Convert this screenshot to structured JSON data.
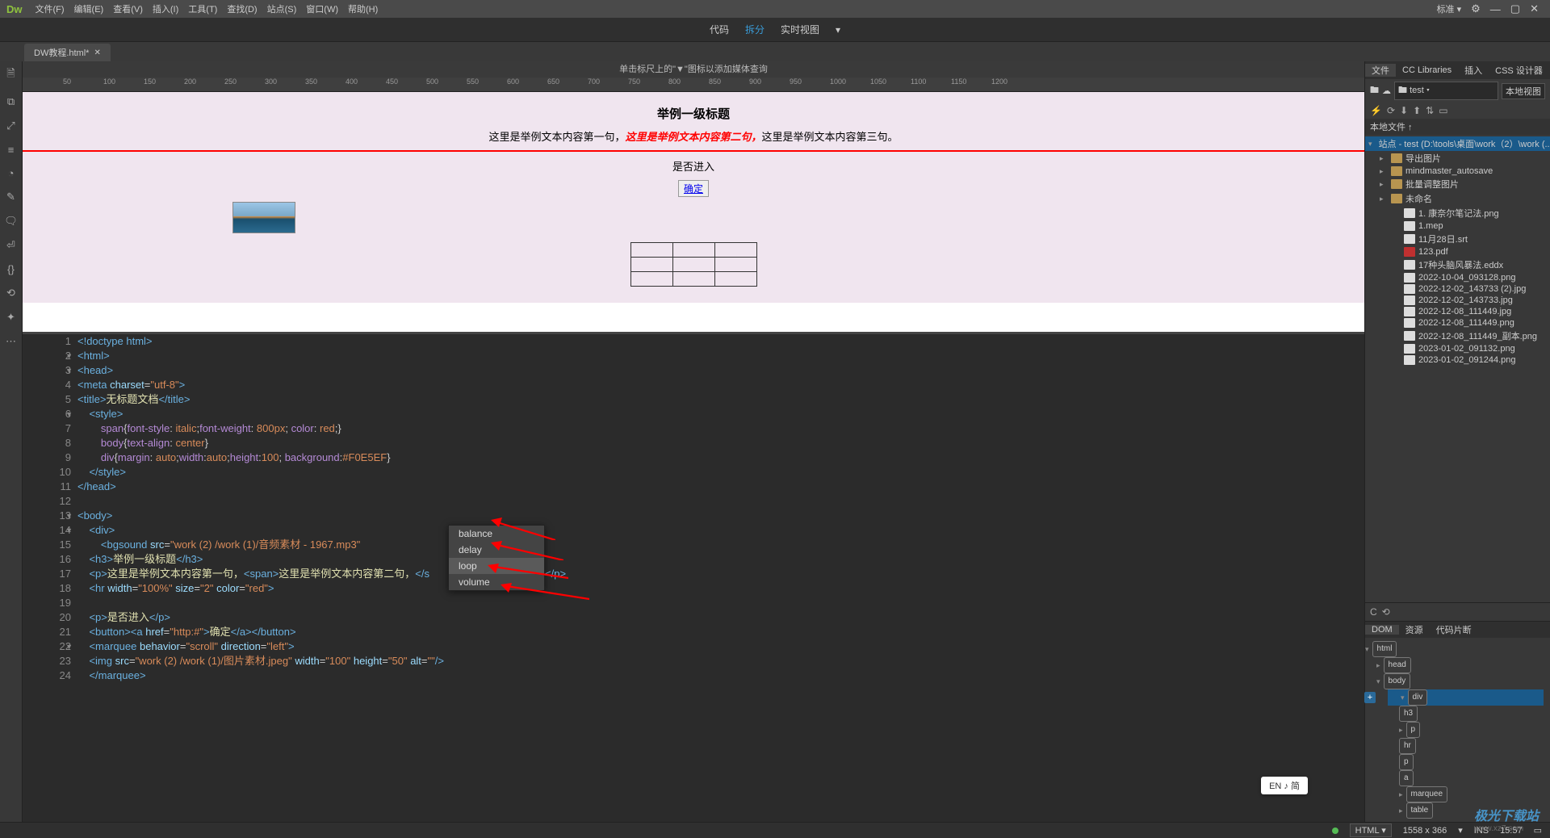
{
  "app": {
    "logo": "Dw"
  },
  "menubar": {
    "items": [
      "文件(F)",
      "编辑(E)",
      "查看(V)",
      "插入(I)",
      "工具(T)",
      "查找(D)",
      "站点(S)",
      "窗口(W)",
      "帮助(H)"
    ],
    "right_label": "标准 ▾"
  },
  "viewbar": {
    "code": "代码",
    "split": "拆分",
    "live": "实时视图"
  },
  "tab": {
    "name": "DW教程.html*"
  },
  "hint": "单击标尺上的\"▼\"图标以添加媒体查询",
  "ruler_ticks": [
    50,
    100,
    150,
    200,
    250,
    300,
    350,
    400,
    450,
    500,
    550,
    600,
    650,
    700,
    750,
    800,
    850,
    900,
    950,
    1000,
    1050,
    1100,
    1150,
    1200
  ],
  "preview": {
    "h3": "举例一级标题",
    "p1a": "这里是举例文本内容第一句，",
    "p1b": "这里是举例文本内容第二句，",
    "p1c": "这里是举例文本内容第三句。",
    "p2": "是否进入",
    "btn": "确定"
  },
  "autocomplete": {
    "items": [
      "balance",
      "delay",
      "loop",
      "volume"
    ],
    "selected": "loop"
  },
  "code": {
    "lines": [
      {
        "n": 1,
        "f": "",
        "html": "<span class='t-tag'>&lt;!doctype html&gt;</span>"
      },
      {
        "n": 2,
        "f": "▼",
        "html": "<span class='t-tag'>&lt;html&gt;</span>"
      },
      {
        "n": 3,
        "f": "▼",
        "html": "<span class='t-tag'>&lt;head&gt;</span>"
      },
      {
        "n": 4,
        "f": "",
        "html": "<span class='t-tag'>&lt;meta</span> <span class='t-attr'>charset</span>=<span class='t-str'>\"utf-8\"</span><span class='t-tag'>&gt;</span>"
      },
      {
        "n": 5,
        "f": "",
        "html": "<span class='t-tag'>&lt;title&gt;</span><span class='t-txt'>无标题文档</span><span class='t-tag'>&lt;/title&gt;</span>"
      },
      {
        "n": 6,
        "f": "▼",
        "html": "    <span class='t-tag'>&lt;style&gt;</span>"
      },
      {
        "n": 7,
        "f": "",
        "html": "        <span class='t-prop'>span</span>{<span class='t-prop'>font-style</span>: <span class='t-val'>italic</span>;<span class='t-prop'>font-weight</span>: <span class='t-val'>800px</span>; <span class='t-prop'>color</span>: <span class='t-val'>red</span>;}"
      },
      {
        "n": 8,
        "f": "",
        "html": "        <span class='t-prop'>body</span>{<span class='t-prop'>text-align</span>: <span class='t-val'>center</span>}"
      },
      {
        "n": 9,
        "f": "",
        "html": "        <span class='t-prop'>div</span>{<span class='t-prop'>margin</span>: <span class='t-val'>auto</span>;<span class='t-prop'>width</span>:<span class='t-val'>auto</span>;<span class='t-prop'>height</span>:<span class='t-val'>100</span>; <span class='t-prop'>background</span>:<span class='t-val'>#F0E5EF</span>}"
      },
      {
        "n": 10,
        "f": "",
        "html": "    <span class='t-tag'>&lt;/style&gt;</span>"
      },
      {
        "n": 11,
        "f": "",
        "html": "<span class='t-tag'>&lt;/head&gt;</span>"
      },
      {
        "n": 12,
        "f": "",
        "html": ""
      },
      {
        "n": 13,
        "f": "▼",
        "html": "<span class='t-tag'>&lt;body&gt;</span>"
      },
      {
        "n": 14,
        "f": "▼",
        "html": "    <span class='t-tag'>&lt;div&gt;</span>"
      },
      {
        "n": 15,
        "f": "",
        "html": "        <span class='t-tag'>&lt;bgsound</span> <span class='t-attr'>src</span>=<span class='t-str'>\"work (2) /work (1)/音频素材 - 1967.mp3\"</span>"
      },
      {
        "n": 16,
        "f": "",
        "html": "    <span class='t-tag'>&lt;h3&gt;</span><span class='t-txt'>举例一级标题</span><span class='t-tag'>&lt;/h3&gt;</span>"
      },
      {
        "n": 17,
        "f": "",
        "html": "    <span class='t-tag'>&lt;p&gt;</span><span class='t-txt'>这里是举例文本内容第一句，</span><span class='t-tag'>&lt;span&gt;</span><span class='t-txt'>这里是举例文本内容第二句，</span><span class='t-tag'>&lt;/s</span>                  <span class='t-txt'>内容第三句。</span><span class='t-tag'>&lt;/p&gt;</span>"
      },
      {
        "n": 18,
        "f": "",
        "html": "    <span class='t-tag'>&lt;hr</span> <span class='t-attr'>width</span>=<span class='t-str'>\"100%\"</span> <span class='t-attr'>size</span>=<span class='t-str'>\"2\"</span> <span class='t-attr'>color</span>=<span class='t-str'>\"red\"</span><span class='t-tag'>&gt;</span>"
      },
      {
        "n": 19,
        "f": "",
        "html": ""
      },
      {
        "n": 20,
        "f": "",
        "html": "    <span class='t-tag'>&lt;p&gt;</span><span class='t-txt'>是否进入</span><span class='t-tag'>&lt;/p&gt;</span>"
      },
      {
        "n": 21,
        "f": "",
        "html": "    <span class='t-tag'>&lt;button&gt;&lt;a</span> <span class='t-attr'>href</span>=<span class='t-str'>\"http:#\"</span><span class='t-tag'>&gt;</span><span class='t-txt'>确定</span><span class='t-tag'>&lt;/a&gt;&lt;/button&gt;</span>"
      },
      {
        "n": 22,
        "f": "▼",
        "html": "    <span class='t-tag'>&lt;marquee</span> <span class='t-attr'>behavior</span>=<span class='t-str'>\"scroll\"</span> <span class='t-attr'>direction</span>=<span class='t-str'>\"left\"</span><span class='t-tag'>&gt;</span>"
      },
      {
        "n": 23,
        "f": "",
        "html": "    <span class='t-tag'>&lt;img</span> <span class='t-attr'>src</span>=<span class='t-str'>\"work (2) /work (1)/图片素材.jpeg\"</span> <span class='t-attr'>width</span>=<span class='t-str'>\"100\"</span> <span class='t-attr'>height</span>=<span class='t-str'>\"50\"</span> <span class='t-attr'>alt</span>=<span class='t-str'>\"\"</span><span class='t-tag'>/&gt;</span>"
      },
      {
        "n": 24,
        "f": "",
        "html": "    <span class='t-tag'>&lt;/marquee&gt;</span>"
      }
    ]
  },
  "filespanel": {
    "tabs": [
      "文件",
      "CC Libraries",
      "插入",
      "CSS 设计器"
    ],
    "site_dropdown": "test",
    "view_dropdown": "本地视图",
    "header": "本地文件 ↑",
    "root": "站点 - test (D:\\tools\\桌面\\work（2）\\work (...",
    "folders": [
      "导出图片",
      "mindmaster_autosave",
      "批量调整图片",
      "未命名"
    ],
    "files": [
      {
        "n": "1. 康奈尔笔记法.png",
        "t": "file"
      },
      {
        "n": "1.mep",
        "t": "file"
      },
      {
        "n": "11月28日.srt",
        "t": "file"
      },
      {
        "n": "123.pdf",
        "t": "pdf"
      },
      {
        "n": "17种头脑风暴法.eddx",
        "t": "file"
      },
      {
        "n": "2022-10-04_093128.png",
        "t": "file"
      },
      {
        "n": "2022-12-02_143733 (2).jpg",
        "t": "file"
      },
      {
        "n": "2022-12-02_143733.jpg",
        "t": "file"
      },
      {
        "n": "2022-12-08_111449.jpg",
        "t": "file"
      },
      {
        "n": "2022-12-08_111449.png",
        "t": "file"
      },
      {
        "n": "2022-12-08_111449_副本.png",
        "t": "file"
      },
      {
        "n": "2023-01-02_091132.png",
        "t": "file"
      },
      {
        "n": "2023-01-02_091244.png",
        "t": "file"
      }
    ]
  },
  "dompanel": {
    "tabs": [
      "DOM",
      "资源",
      "代码片断"
    ],
    "tree": [
      "html",
      "head",
      "body",
      "div",
      "h3",
      "p",
      "hr",
      "p",
      "a",
      "marquee",
      "table"
    ]
  },
  "statusbar": {
    "lang": "HTML",
    "dims": "1558 x 366",
    "mode": "INS",
    "time": "15:57"
  },
  "ime": "EN ♪ 简",
  "watermark": {
    "main": "极光下载站",
    "sub": "www.xz7.com"
  }
}
